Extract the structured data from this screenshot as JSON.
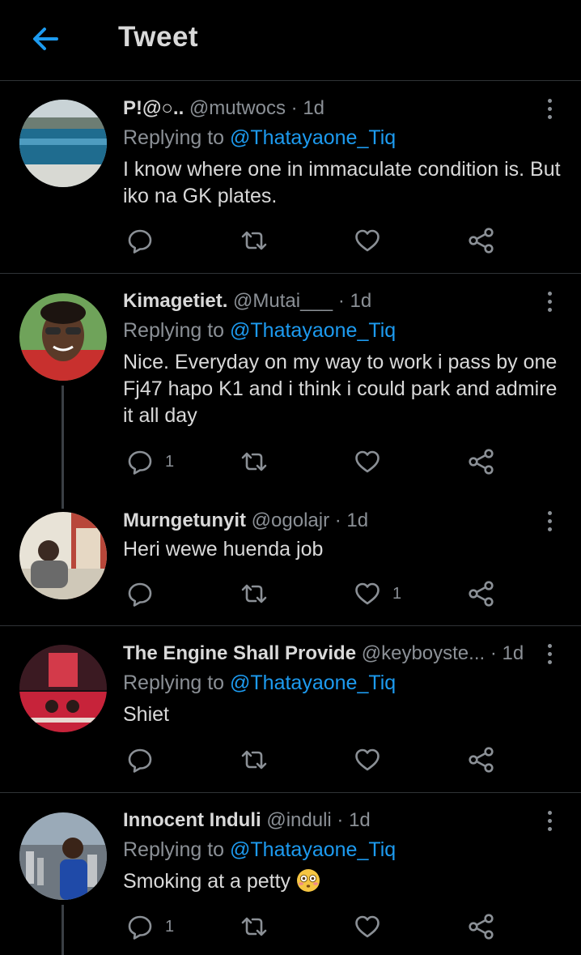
{
  "header": {
    "title": "Tweet",
    "back_icon": "back-arrow-icon",
    "accent": "#1d9bf0"
  },
  "tweets": [
    {
      "name": "P!@○..",
      "handle": "@mutwocs",
      "dot": "·",
      "time": "1d",
      "replying_label": "Replying to",
      "replying_to": "@Thatayaone_Tiq",
      "text": "I know where one in immaculate condition is. But iko na GK plates.",
      "reply_count": "",
      "like_count": ""
    },
    {
      "name": "Kimagetiet.",
      "handle": "@Mutai___",
      "dot": "·",
      "time": "1d",
      "replying_label": "Replying to",
      "replying_to": "@Thatayaone_Tiq",
      "text": "Nice. Everyday on my way to work i pass by one Fj47 hapo K1 and i think i could park and admire it all day",
      "reply_count": "1",
      "like_count": ""
    },
    {
      "name": "Murngetunyit",
      "handle": "@ogolajr",
      "dot": "·",
      "time": "1d",
      "text": "Heri wewe huenda job",
      "reply_count": "",
      "like_count": "1"
    },
    {
      "name": "The Engine Shall Provide",
      "handle": "@keyboyste...",
      "dot": "·",
      "time": "1d",
      "replying_label": "Replying to",
      "replying_to": "@Thatayaone_Tiq",
      "text": "Shiet",
      "reply_count": "",
      "like_count": ""
    },
    {
      "name": "Innocent Induli",
      "handle": "@induli",
      "dot": "·",
      "time": "1d",
      "replying_label": "Replying to",
      "replying_to": "@Thatayaone_Tiq",
      "text": "Smoking at a petty",
      "emoji": "flushed-face-emoji",
      "reply_count": "1",
      "like_count": ""
    }
  ]
}
